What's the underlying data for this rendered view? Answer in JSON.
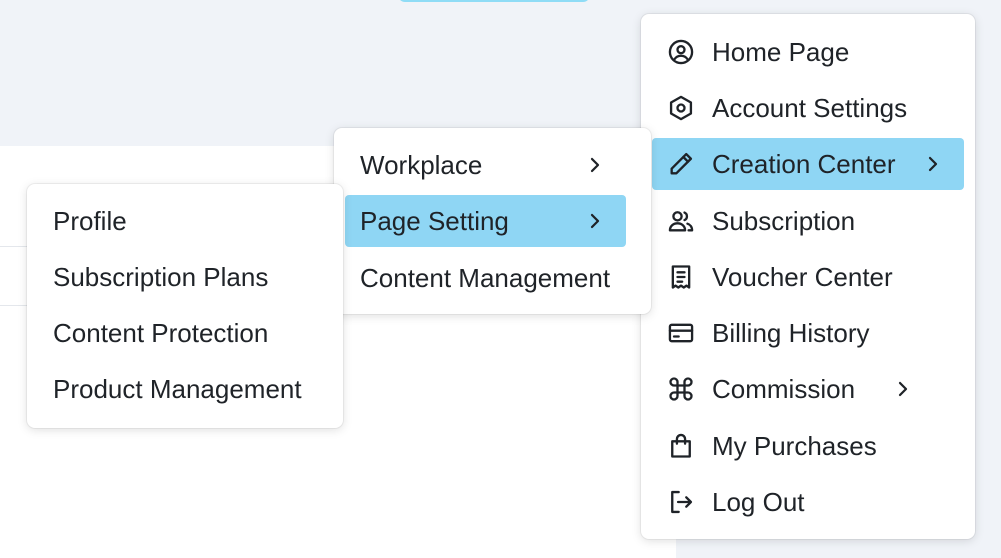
{
  "main_menu": {
    "items": [
      {
        "label": "Home Page",
        "icon": "user-circle-icon"
      },
      {
        "label": "Account Settings",
        "icon": "hexagon-gear-icon"
      },
      {
        "label": "Creation Center",
        "icon": "pencil-icon",
        "active": true,
        "submenu": true
      },
      {
        "label": "Subscription",
        "icon": "users-icon"
      },
      {
        "label": "Voucher Center",
        "icon": "receipt-icon"
      },
      {
        "label": "Billing History",
        "icon": "credit-card-icon"
      },
      {
        "label": "Commission",
        "icon": "command-icon",
        "submenu": true
      },
      {
        "label": "My Purchases",
        "icon": "shopping-bag-icon"
      },
      {
        "label": "Log Out",
        "icon": "logout-icon"
      }
    ]
  },
  "creation_submenu": {
    "items": [
      {
        "label": "Workplace",
        "submenu": true
      },
      {
        "label": "Page Setting",
        "submenu": true,
        "active": true
      },
      {
        "label": "Content Management"
      }
    ]
  },
  "page_setting_submenu": {
    "items": [
      {
        "label": "Profile"
      },
      {
        "label": "Subscription Plans"
      },
      {
        "label": "Content Protection"
      },
      {
        "label": "Product Management"
      }
    ]
  },
  "colors": {
    "active_highlight": "#8fd6f4",
    "page_background": "#f0f3f8"
  }
}
